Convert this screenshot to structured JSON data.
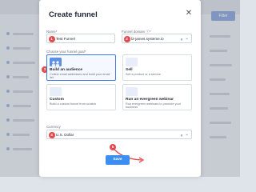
{
  "background": {
    "filter_label": "Filter"
  },
  "modal": {
    "title": "Create funnel",
    "close_symbol": "✕",
    "name": {
      "label": "Name*",
      "value": "Test Funnel",
      "step": "1"
    },
    "domain": {
      "label": "Funnel domain ⓘ*",
      "value": "l2-james.systeme.io",
      "step": "2",
      "clear_symbol": "✕",
      "chevron_symbol": "⌄"
    },
    "goal": {
      "label": "Choose your funnel goal*",
      "step": "3",
      "options": [
        {
          "title": "Build an audience",
          "desc": "Collect email addresses and build your email list"
        },
        {
          "title": "Sell",
          "desc": "Sell a product or a service"
        },
        {
          "title": "Custom",
          "desc": "Build a custom funnel from scratch"
        },
        {
          "title": "Run an evergreen webinar",
          "desc": "Run evergreen webinars to promote your business"
        }
      ]
    },
    "currency": {
      "label": "Currency",
      "value": "U.S. Dollar",
      "step": "4",
      "clear_symbol": "✕",
      "chevron_symbol": "⌄"
    },
    "save": {
      "label": "Save",
      "step": "5"
    }
  },
  "colors": {
    "accent": "#3c8ff0",
    "badge": "#e5484d",
    "selected_border": "#3c7be0"
  }
}
